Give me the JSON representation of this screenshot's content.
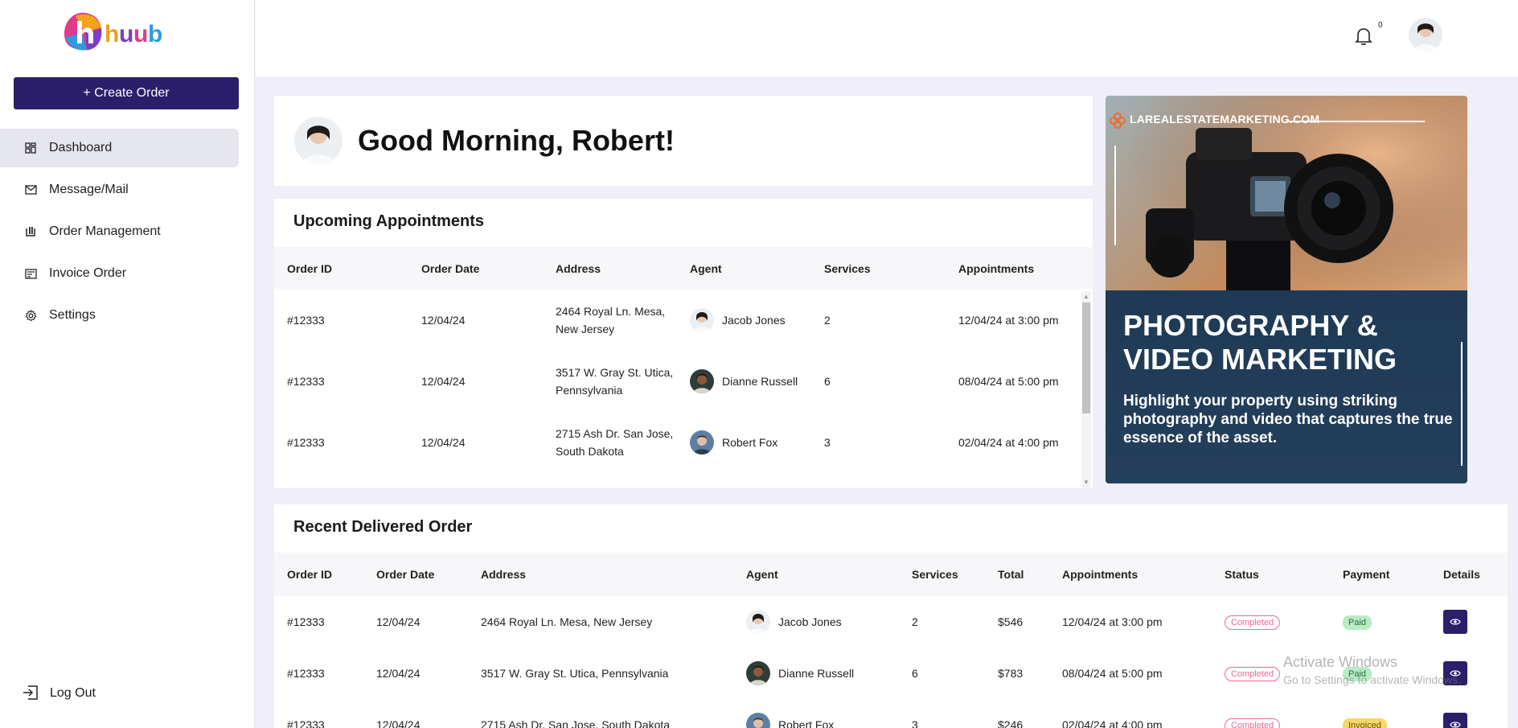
{
  "logo": {
    "text": "huub",
    "tagline": ""
  },
  "sidebar": {
    "create_label": "+ Create Order",
    "items": [
      {
        "label": "Dashboard",
        "icon": "grid-icon",
        "active": true
      },
      {
        "label": "Message/Mail",
        "icon": "mail-icon",
        "active": false
      },
      {
        "label": "Order Management",
        "icon": "order-icon",
        "active": false
      },
      {
        "label": "Invoice Order",
        "icon": "invoice-icon",
        "active": false
      },
      {
        "label": "Settings",
        "icon": "gear-icon",
        "active": false
      }
    ],
    "logout_label": "Log Out"
  },
  "topbar": {
    "notification_count": "0"
  },
  "greeting": {
    "text": "Good Morning, Robert!"
  },
  "upcoming": {
    "title": "Upcoming Appointments",
    "columns": [
      "Order ID",
      "Order Date",
      "Address",
      "Agent",
      "Services",
      "Appointments"
    ],
    "rows": [
      {
        "id": "#12333",
        "date": "12/04/24",
        "address": "2464 Royal Ln. Mesa, New Jersey",
        "agent": "Jacob Jones",
        "services": "2",
        "appointment": "12/04/24 at 3:00 pm"
      },
      {
        "id": "#12333",
        "date": "12/04/24",
        "address": "3517 W. Gray St. Utica, Pennsylvania",
        "agent": "Dianne Russell",
        "services": "6",
        "appointment": "08/04/24 at 5:00 pm"
      },
      {
        "id": "#12333",
        "date": "12/04/24",
        "address": "2715 Ash Dr. San Jose, South Dakota",
        "agent": "Robert Fox",
        "services": "3",
        "appointment": "02/04/24 at 4:00 pm"
      }
    ]
  },
  "banner": {
    "site": "LAREALESTATEMARKETING.COM",
    "headline_1": "PHOTOGRAPHY &",
    "headline_2": "VIDEO MARKETING",
    "body": "Highlight your property using striking photography and video that captures the true essence of the asset."
  },
  "recent": {
    "title": "Recent Delivered Order",
    "columns": [
      "Order ID",
      "Order Date",
      "Address",
      "Agent",
      "Services",
      "Total",
      "Appointments",
      "Status",
      "Payment",
      "Details"
    ],
    "rows": [
      {
        "id": "#12333",
        "date": "12/04/24",
        "address": "2464 Royal Ln. Mesa, New Jersey",
        "agent": "Jacob Jones",
        "services": "2",
        "total": "$546",
        "appointment": "12/04/24 at 3:00 pm",
        "status": "Completed",
        "payment": "Paid"
      },
      {
        "id": "#12333",
        "date": "12/04/24",
        "address": "3517 W. Gray St. Utica, Pennsylvania",
        "agent": "Dianne Russell",
        "services": "6",
        "total": "$783",
        "appointment": "08/04/24 at 5:00 pm",
        "status": "Completed",
        "payment": "Paid"
      },
      {
        "id": "#12333",
        "date": "12/04/24",
        "address": "2715 Ash Dr. San Jose, South Dakota",
        "agent": "Robert Fox",
        "services": "3",
        "total": "$246",
        "appointment": "02/04/24 at 4:00 pm",
        "status": "Completed",
        "payment": "Invoiced"
      }
    ]
  },
  "watermark": {
    "title": "Activate Windows",
    "subtitle": "Go to Settings to activate Windows."
  },
  "colors": {
    "primary": "#2b1f6b",
    "page_bg": "#efeef9",
    "status_pink": "#e96a8f",
    "paid_green": "#b7ecc5",
    "invoiced_yellow": "#f6d86a"
  }
}
